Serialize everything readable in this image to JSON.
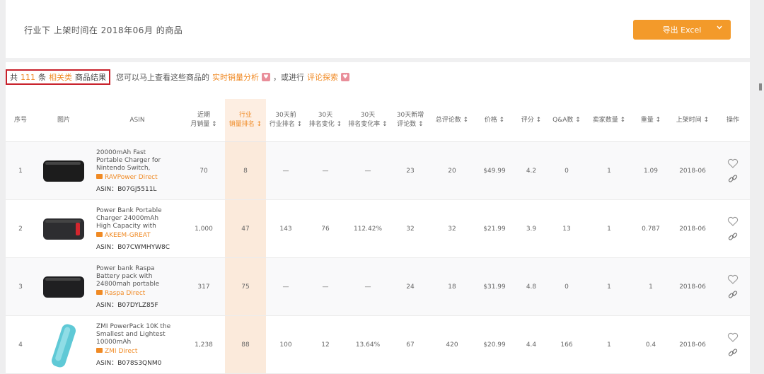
{
  "header": {
    "filter_text": "行业下 上架时间在 2018年06月 的商品",
    "export_label": "导出 Excel"
  },
  "summary": {
    "prefix": "共",
    "count": "111",
    "unit": "条",
    "tag": "相关类",
    "label": "商品结果",
    "hint_1": "您可以马上查看这些商品的",
    "link_1": "实时销量分析",
    "hint_2": "，或进行",
    "link_2": "评论探索"
  },
  "table": {
    "columns": [
      "序号",
      "图片",
      "ASIN",
      "近期\n月销量 ↕",
      "行业\n销量排名 ↕",
      "30天前\n行业排名 ↕",
      "30天\n排名变化 ↕",
      "30天\n排名变化率 ↕",
      "30天新增\n评论数 ↕",
      "总评论数 ↕",
      "价格 ↕",
      "评分 ↕",
      "Q&A数 ↕",
      "卖家数量 ↕",
      "重量 ↕",
      "上架时间 ↕",
      "操作"
    ],
    "rows": [
      {
        "index": "1",
        "title": "20000mAh Fast Portable Charger for Nintendo Switch,",
        "store": "RAVPower Direct",
        "asin": "ASIN：B07GJ5511L",
        "sales": "70",
        "rank": "8",
        "rank_30": "—",
        "change": "—",
        "change_rate": "—",
        "new_reviews": "23",
        "reviews": "20",
        "price": "$49.99",
        "rating": "4.2",
        "qa": "0",
        "sellers": "1",
        "weight": "1.09",
        "date": "2018-06",
        "img_color": "#1c1c1c",
        "img_shape": "slab"
      },
      {
        "index": "2",
        "title": "Power Bank Portable Charger 24000mAh High Capacity with",
        "store": "AKEEM-GREAT",
        "asin": "ASIN：B07CWMHYW8C",
        "sales": "1,000",
        "rank": "47",
        "rank_30": "143",
        "change": "76",
        "change_rate": "112.42%",
        "new_reviews": "32",
        "reviews": "32",
        "price": "$21.99",
        "rating": "3.9",
        "qa": "13",
        "sellers": "1",
        "weight": "0.787",
        "date": "2018-06",
        "img_color": "#2d2d30",
        "img_shape": "slab-red"
      },
      {
        "index": "3",
        "title": "Power bank Raspa Battery pack with 24800mah portable",
        "store": "Raspa Direct",
        "asin": "ASIN：B07DYLZ85F",
        "sales": "317",
        "rank": "75",
        "rank_30": "—",
        "change": "—",
        "change_rate": "—",
        "new_reviews": "24",
        "reviews": "18",
        "price": "$31.99",
        "rating": "4.8",
        "qa": "0",
        "sellers": "1",
        "weight": "1",
        "date": "2018-06",
        "img_color": "#1f1f21",
        "img_shape": "slab"
      },
      {
        "index": "4",
        "title": "ZMI PowerPack 10K the Smallest and Lightest 10000mAh",
        "store": "ZMI Direct",
        "asin": "ASIN：B078S3QNM0",
        "sales": "1,238",
        "rank": "88",
        "rank_30": "100",
        "change": "12",
        "change_rate": "13.64%",
        "new_reviews": "67",
        "reviews": "420",
        "price": "$20.99",
        "rating": "4.4",
        "qa": "166",
        "sellers": "1",
        "weight": "0.4",
        "date": "2018-06",
        "img_color": "#5fc9d6",
        "img_shape": "stick"
      }
    ]
  },
  "colors": {
    "accent": "#f39a2a",
    "highlight_col": "#fbeadb",
    "summary_box": "#c8202a"
  },
  "icons": [
    "chevron-down-icon",
    "heart-icon",
    "link-icon",
    "cart-icon"
  ]
}
